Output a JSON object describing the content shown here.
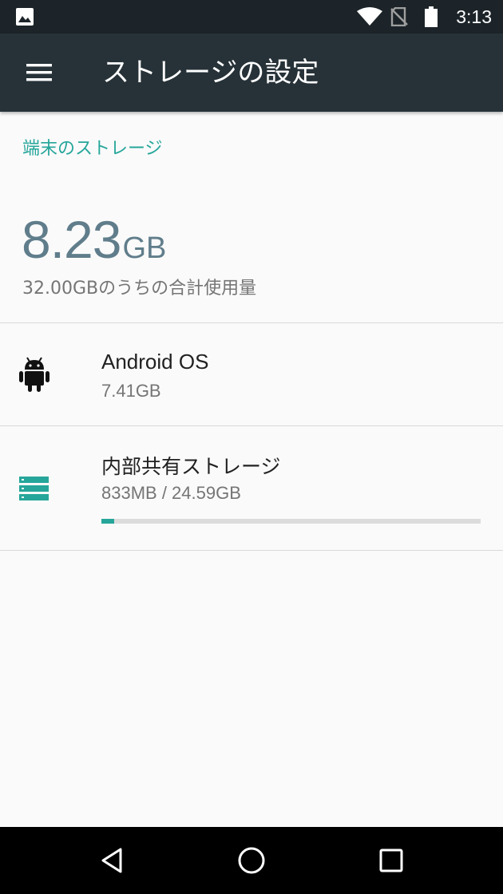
{
  "status_bar": {
    "time": "3:13",
    "icons": [
      "gallery-icon",
      "wifi-icon",
      "no-sim-icon",
      "battery-icon"
    ]
  },
  "app_bar": {
    "title": "ストレージの設定",
    "menu_icon": "menu-icon"
  },
  "device_storage": {
    "header": "端末のストレージ",
    "used_value": "8.23",
    "used_unit": "GB",
    "caption": "32.00GBのうちの合計使用量"
  },
  "items": [
    {
      "title": "Android OS",
      "subtitle": "7.41GB",
      "icon": "android-icon"
    },
    {
      "title": "内部共有ストレージ",
      "subtitle": "833MB / 24.59GB",
      "icon": "storage-icon",
      "progress_fraction": 0.033
    }
  ],
  "nav_bar": {
    "buttons": [
      "back-icon",
      "home-icon",
      "recents-icon"
    ]
  },
  "colors": {
    "status_bar": "#1c2429",
    "app_bar": "#263238",
    "accent": "#26a69a",
    "large_value": "#607d8b",
    "background": "#fafafa"
  }
}
